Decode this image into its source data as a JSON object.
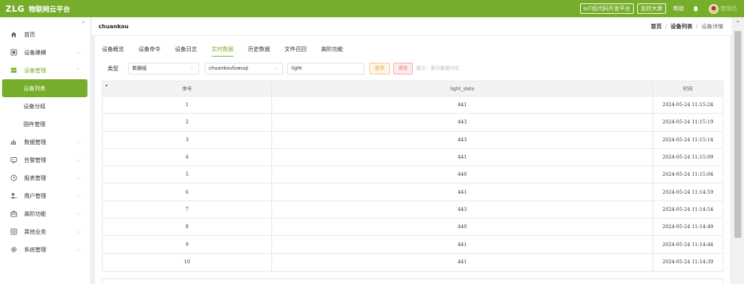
{
  "header": {
    "logo_mark": "ZLG",
    "logo_text": "物联网云平台",
    "buttons": [
      "IoT低代码开发平台",
      "监控大屏"
    ],
    "help": "帮助",
    "username": "管理员"
  },
  "sidebar": {
    "collapse_icon": "«",
    "items": [
      {
        "label": "首页",
        "icon": "home-icon"
      },
      {
        "label": "设备建模",
        "icon": "model-icon"
      },
      {
        "label": "设备管理",
        "icon": "device-icon"
      },
      {
        "label": "数据管理",
        "icon": "data-icon"
      },
      {
        "label": "告警管理",
        "icon": "alarm-icon"
      },
      {
        "label": "报表管理",
        "icon": "report-icon"
      },
      {
        "label": "用户管理",
        "icon": "user-icon"
      },
      {
        "label": "高阶功能",
        "icon": "advanced-icon"
      },
      {
        "label": "其他业务",
        "icon": "other-icon"
      },
      {
        "label": "系统管理",
        "icon": "system-icon"
      }
    ],
    "sub_items": [
      {
        "label": "设备列表"
      },
      {
        "label": "设备分组"
      },
      {
        "label": "固件管理"
      }
    ]
  },
  "page": {
    "device_name": "chuankou",
    "breadcrumb": [
      "首页",
      "设备列表",
      "设备详情"
    ]
  },
  "tabs": [
    "设备概览",
    "设备命令",
    "设备日志",
    "实时数据",
    "历史数据",
    "文件召回",
    "高阶功能"
  ],
  "filters": {
    "type_label": "类型",
    "type_value": "数据组",
    "device_value": "chuankoufuwuqi",
    "field_value": "light",
    "pause_label": "暂停",
    "clear_label": "清空",
    "hint": "提示：索引数据为空"
  },
  "table": {
    "columns": [
      "序号",
      "light_data",
      "时间"
    ],
    "rows": [
      [
        "1",
        "441",
        "2024-05-24 11:15:24"
      ],
      [
        "2",
        "443",
        "2024-05-24 11:15:19"
      ],
      [
        "3",
        "443",
        "2024-05-24 11:15:14"
      ],
      [
        "4",
        "441",
        "2024-05-24 11:15:09"
      ],
      [
        "5",
        "440",
        "2024-05-24 11:15:04"
      ],
      [
        "6",
        "441",
        "2024-05-24 11:14:59"
      ],
      [
        "7",
        "443",
        "2024-05-24 11:14:54"
      ],
      [
        "8",
        "440",
        "2024-05-24 11:14:49"
      ],
      [
        "9",
        "441",
        "2024-05-24 11:14:44"
      ],
      [
        "10",
        "441",
        "2024-05-24 11:14:39"
      ]
    ]
  },
  "colors": {
    "brand": "#76ad2a",
    "pause": "#e6a23c",
    "clear": "#f56c6c"
  }
}
